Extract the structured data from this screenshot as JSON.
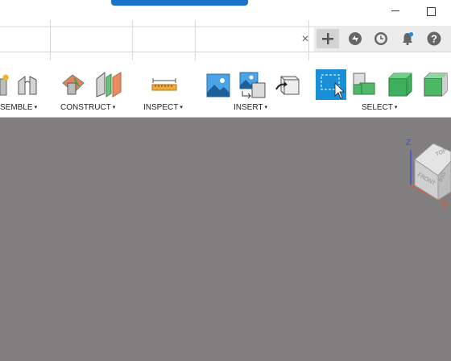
{
  "toolbar": {
    "groups": {
      "assemble": "SEMBLE",
      "construct": "CONSTRUCT",
      "inspect": "INSPECT",
      "insert": "INSERT",
      "select": "SELECT"
    },
    "caret": "▾"
  },
  "tabbar": {
    "close_glyph": "×"
  },
  "viewcube": {
    "top": "TOP",
    "front": "FRONT",
    "right": "RIG",
    "axis_z": "Z",
    "axis_x": "X"
  },
  "colors": {
    "canvas": "#817e80",
    "accent": "#1a8fd8",
    "title_accent": "#1a73c7"
  }
}
